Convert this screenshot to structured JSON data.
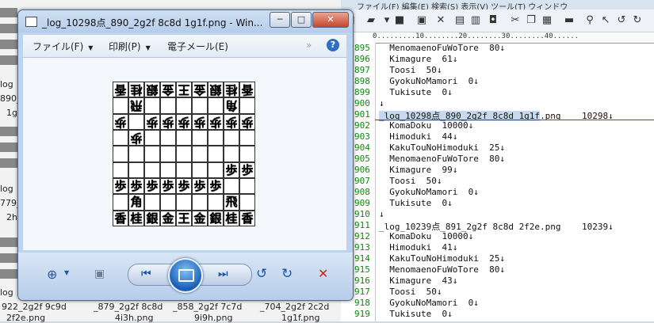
{
  "viewer": {
    "title": "_log_10298点_890_2g2f 8c8d 1g1f.png - Win...",
    "menu": {
      "file": "ファイル(F)",
      "print": "印刷(P)",
      "email": "電子メール(E)",
      "overflow": "»",
      "help": "?"
    },
    "window_buttons": {
      "minimize": "─",
      "maximize": "□",
      "close": "✕"
    },
    "controls": {
      "zoom": "zoom-icon",
      "fit": "actual-size-icon",
      "prev": "previous-icon",
      "slideshow": "slideshow-icon",
      "next": "next-icon",
      "rotate_ccw": "rotate-ccw-icon",
      "rotate_cw": "rotate-cw-icon",
      "delete": "delete-icon"
    }
  },
  "board": {
    "rows": [
      [
        {
          "p": "香",
          "g": true
        },
        {
          "p": "桂",
          "g": true
        },
        {
          "p": "銀",
          "g": true
        },
        {
          "p": "金",
          "g": true
        },
        {
          "p": "王",
          "g": true
        },
        {
          "p": "金",
          "g": true
        },
        {
          "p": "銀",
          "g": true
        },
        {
          "p": "桂",
          "g": true
        },
        {
          "p": "香",
          "g": true
        }
      ],
      [
        null,
        {
          "p": "飛",
          "g": true
        },
        null,
        null,
        null,
        null,
        null,
        {
          "p": "角",
          "g": true
        },
        null
      ],
      [
        {
          "p": "歩",
          "g": true
        },
        null,
        {
          "p": "歩",
          "g": true
        },
        {
          "p": "歩",
          "g": true
        },
        {
          "p": "歩",
          "g": true
        },
        {
          "p": "歩",
          "g": true
        },
        {
          "p": "歩",
          "g": true
        },
        {
          "p": "歩",
          "g": true
        },
        {
          "p": "歩",
          "g": true
        }
      ],
      [
        null,
        {
          "p": "歩",
          "g": true
        },
        null,
        null,
        null,
        null,
        null,
        null,
        null
      ],
      [
        null,
        null,
        null,
        null,
        null,
        null,
        null,
        null,
        null
      ],
      [
        null,
        null,
        null,
        null,
        null,
        null,
        null,
        {
          "p": "歩",
          "g": false
        },
        {
          "p": "歩",
          "g": false
        }
      ],
      [
        {
          "p": "歩",
          "g": false
        },
        {
          "p": "歩",
          "g": false
        },
        {
          "p": "歩",
          "g": false
        },
        {
          "p": "歩",
          "g": false
        },
        {
          "p": "歩",
          "g": false
        },
        {
          "p": "歩",
          "g": false
        },
        {
          "p": "歩",
          "g": false
        },
        null,
        null
      ],
      [
        null,
        {
          "p": "角",
          "g": false
        },
        null,
        null,
        null,
        null,
        null,
        {
          "p": "飛",
          "g": false
        },
        null
      ],
      [
        {
          "p": "香",
          "g": false
        },
        {
          "p": "桂",
          "g": false
        },
        {
          "p": "銀",
          "g": false
        },
        {
          "p": "金",
          "g": false
        },
        {
          "p": "王",
          "g": false
        },
        {
          "p": "金",
          "g": false
        },
        {
          "p": "銀",
          "g": false
        },
        {
          "p": "桂",
          "g": false
        },
        {
          "p": "香",
          "g": false
        }
      ]
    ]
  },
  "editor": {
    "menu_fragment": "ファイル(F)  編集(E)  検索(S)  表示(V)  ツール(T)  ウィンドウ",
    "ruler": "0.........10........20........30........40......",
    "lines": [
      {
        "n": "895",
        "t": "  MenomaenoFuWoTore  80↓"
      },
      {
        "n": "896",
        "t": "  Kimagure  61↓"
      },
      {
        "n": "897",
        "t": "  Toosi  50↓"
      },
      {
        "n": "898",
        "t": "  GyokuNoMamori  0↓"
      },
      {
        "n": "899",
        "t": "  Tukisute  0↓"
      },
      {
        "n": "900",
        "t": "↓"
      },
      {
        "n": "901",
        "t": "_log_10298点_890_2g2f 8c8d 1g1f.png    10298↓",
        "hl": "_log_10298点_890_2g2f 8c8d 1g1f"
      },
      {
        "n": "902",
        "t": "  KomaDoku  10000↓"
      },
      {
        "n": "903",
        "t": "  Himoduki  44↓"
      },
      {
        "n": "904",
        "t": "  KakuTouNoHimoduki  25↓"
      },
      {
        "n": "905",
        "t": "  MenomaenoFuWoTore  80↓"
      },
      {
        "n": "906",
        "t": "  Kimagure  99↓"
      },
      {
        "n": "907",
        "t": "  Toosi  50↓"
      },
      {
        "n": "908",
        "t": "  GyokuNoMamori  0↓"
      },
      {
        "n": "909",
        "t": "  Tukisute  0↓"
      },
      {
        "n": "910",
        "t": "↓"
      },
      {
        "n": "911",
        "t": "_log_10239点_891_2g2f 8c8d 2f2e.png    10239↓"
      },
      {
        "n": "912",
        "t": "  KomaDoku  10000↓"
      },
      {
        "n": "913",
        "t": "  Himoduki  41↓"
      },
      {
        "n": "914",
        "t": "  KakuTouNoHimoduki  25↓"
      },
      {
        "n": "915",
        "t": "  MenomaenoFuWoTore  80↓"
      },
      {
        "n": "916",
        "t": "  Kimagure  43↓"
      },
      {
        "n": "917",
        "t": "  Toosi  50↓"
      },
      {
        "n": "918",
        "t": "  GyokuNoMamori  0↓"
      },
      {
        "n": "919",
        "t": "  Tukisute  0↓"
      }
    ]
  },
  "explorer": {
    "left_fragments": [
      "log",
      "890_",
      "1g",
      "log",
      "779_",
      "2h",
      "log"
    ],
    "thumb_labels": [
      "922_2g2f 9c9d",
      "_879_2g2f 8c8d",
      "_858_2g2f 7c7d",
      "_704_2g2f 2c2d"
    ],
    "thumb_labels2": [
      "2f2e.png",
      "4i3h.png",
      "9i9h.png",
      "1g1f.png"
    ]
  }
}
